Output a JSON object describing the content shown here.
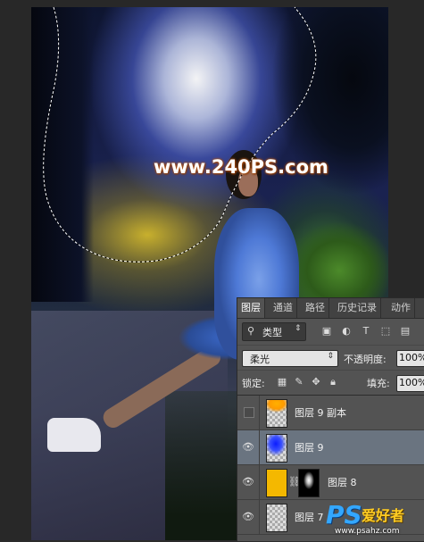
{
  "watermark": {
    "text": "www.240PS.com"
  },
  "tabs": [
    "图层",
    "通道",
    "路径",
    "历史记录",
    "动作"
  ],
  "filter": {
    "label": "类型",
    "icon": "search-icon"
  },
  "blend": {
    "mode": "柔光",
    "opacity_label": "不透明度:",
    "opacity_value": "100%"
  },
  "lock": {
    "label": "锁定:",
    "fill_label": "填充:",
    "fill_value": "100%"
  },
  "layers": [
    {
      "name": "图层 9 副本",
      "visible": false,
      "selected": false
    },
    {
      "name": "图层 9",
      "visible": true,
      "selected": true
    },
    {
      "name": "图层 8",
      "visible": true,
      "selected": false
    },
    {
      "name": "图层 7",
      "visible": true,
      "selected": false
    }
  ],
  "logo": {
    "ps": "PS",
    "cn": "爱好者",
    "url": "www.psahz.com"
  },
  "colors": {
    "panel": "#535353",
    "selected_row": "#6a7480",
    "accent_blue": "#33a7ff"
  }
}
